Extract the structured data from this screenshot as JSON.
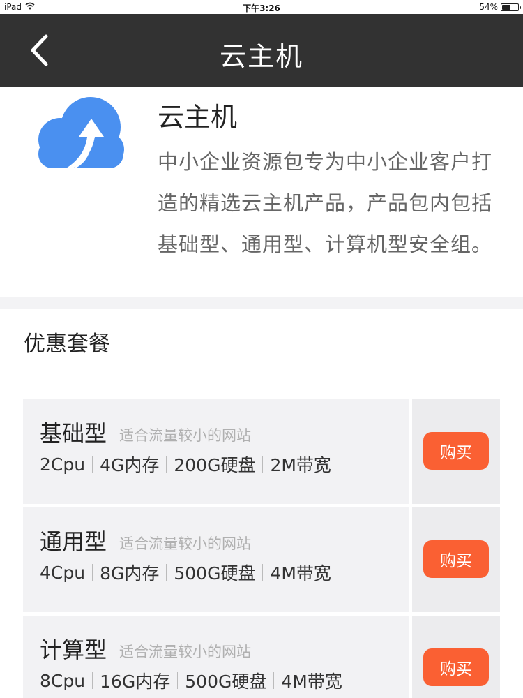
{
  "statusbar": {
    "device": "iPad",
    "time": "下午3:26",
    "battery": "54%",
    "battery_level": 54
  },
  "header": {
    "title": "云主机"
  },
  "product": {
    "name": "云主机",
    "description": "中小企业资源包专为中小企业客户打造的精选云主机产品，产品包内包括基础型、通用型、计算机型安全组。"
  },
  "section": {
    "title": "优惠套餐"
  },
  "plans": [
    {
      "name": "基础型",
      "tag": "适合流量较小的网站",
      "specs": [
        "2Cpu",
        "4G内存",
        "200G硬盘",
        "2M带宽"
      ],
      "buy_label": "购买"
    },
    {
      "name": "通用型",
      "tag": "适合流量较小的网站",
      "specs": [
        "4Cpu",
        "8G内存",
        "500G硬盘",
        "4M带宽"
      ],
      "buy_label": "购买"
    },
    {
      "name": "计算型",
      "tag": "适合流量较小的网站",
      "specs": [
        "8Cpu",
        "16G内存",
        "500G硬盘",
        "4M带宽"
      ],
      "buy_label": "购买"
    }
  ],
  "colors": {
    "nav_bg": "#323232",
    "accent": "#fa6033",
    "logo_blue": "#4a90f0"
  },
  "icons": {
    "back": "chevron-left-icon",
    "logo": "cloud-upload-icon",
    "wifi": "wifi-icon",
    "battery": "battery-icon"
  }
}
